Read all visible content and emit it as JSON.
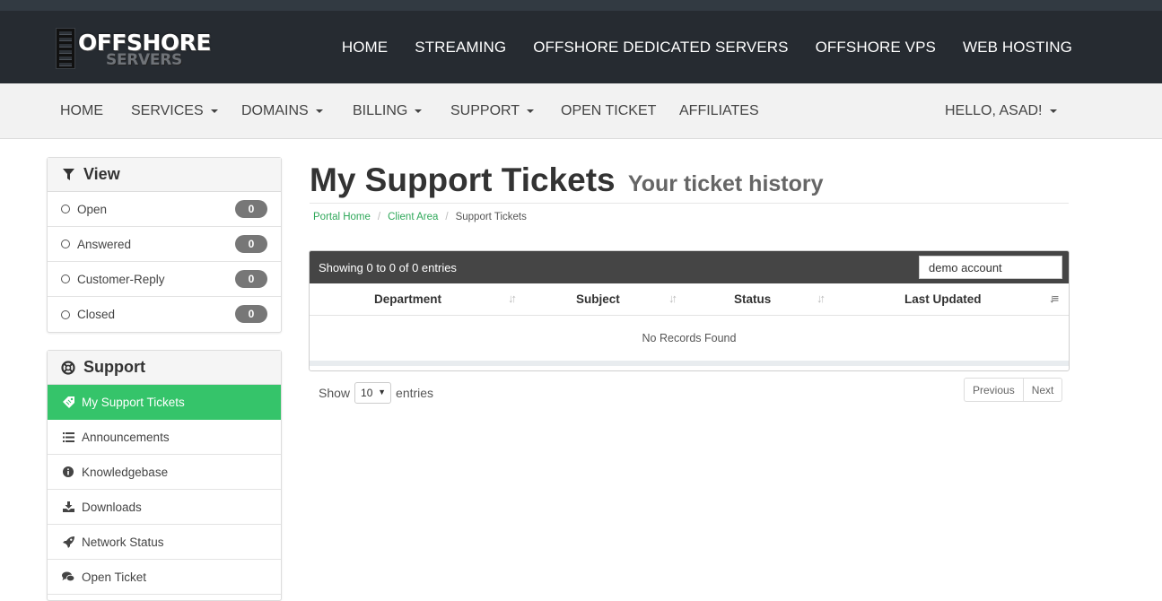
{
  "brand": {
    "logo_line1": "OFFSHORE",
    "logo_line2": "SERVERS"
  },
  "top_nav": [
    {
      "label": "HOME"
    },
    {
      "label": "STREAMING"
    },
    {
      "label": "OFFSHORE DEDICATED SERVERS"
    },
    {
      "label": "OFFSHORE VPS"
    },
    {
      "label": "WEB HOSTING"
    }
  ],
  "client_nav": {
    "items": [
      {
        "label": "HOME"
      },
      {
        "label": "SERVICES"
      },
      {
        "label": "DOMAINS"
      },
      {
        "label": "BILLING"
      },
      {
        "label": "SUPPORT"
      },
      {
        "label": "OPEN TICKET"
      },
      {
        "label": "AFFILIATES"
      }
    ],
    "user_menu": "HELLO, ASAD!"
  },
  "view_panel": {
    "title": "View",
    "filters": [
      {
        "label": "Open",
        "count": "0"
      },
      {
        "label": "Answered",
        "count": "0"
      },
      {
        "label": "Customer-Reply",
        "count": "0"
      },
      {
        "label": "Closed",
        "count": "0"
      }
    ]
  },
  "support_panel": {
    "title": "Support",
    "items": [
      {
        "label": "My Support Tickets",
        "icon": "ticket-icon",
        "active": true
      },
      {
        "label": "Announcements",
        "icon": "list-icon"
      },
      {
        "label": "Knowledgebase",
        "icon": "info-circle-icon"
      },
      {
        "label": "Downloads",
        "icon": "download-icon"
      },
      {
        "label": "Network Status",
        "icon": "rocket-icon"
      },
      {
        "label": "Open Ticket",
        "icon": "comments-icon"
      }
    ]
  },
  "page": {
    "title": "My Support Tickets",
    "subtitle": "Your ticket history",
    "breadcrumb": {
      "home": "Portal Home",
      "client_area": "Client Area",
      "current": "Support Tickets"
    }
  },
  "table": {
    "info": "Showing 0 to 0 of 0 entries",
    "search_value": "demo account",
    "columns": [
      "Department",
      "Subject",
      "Status",
      "Last Updated"
    ],
    "empty_message": "No Records Found",
    "show_label": "Show",
    "page_length": "10",
    "entries_label": "entries",
    "prev_label": "Previous",
    "next_label": "Next"
  },
  "colors": {
    "header_bg": "#262b31",
    "active_green": "#35c46a",
    "badge_grey": "#777777",
    "link_green": "#2fa85a"
  }
}
